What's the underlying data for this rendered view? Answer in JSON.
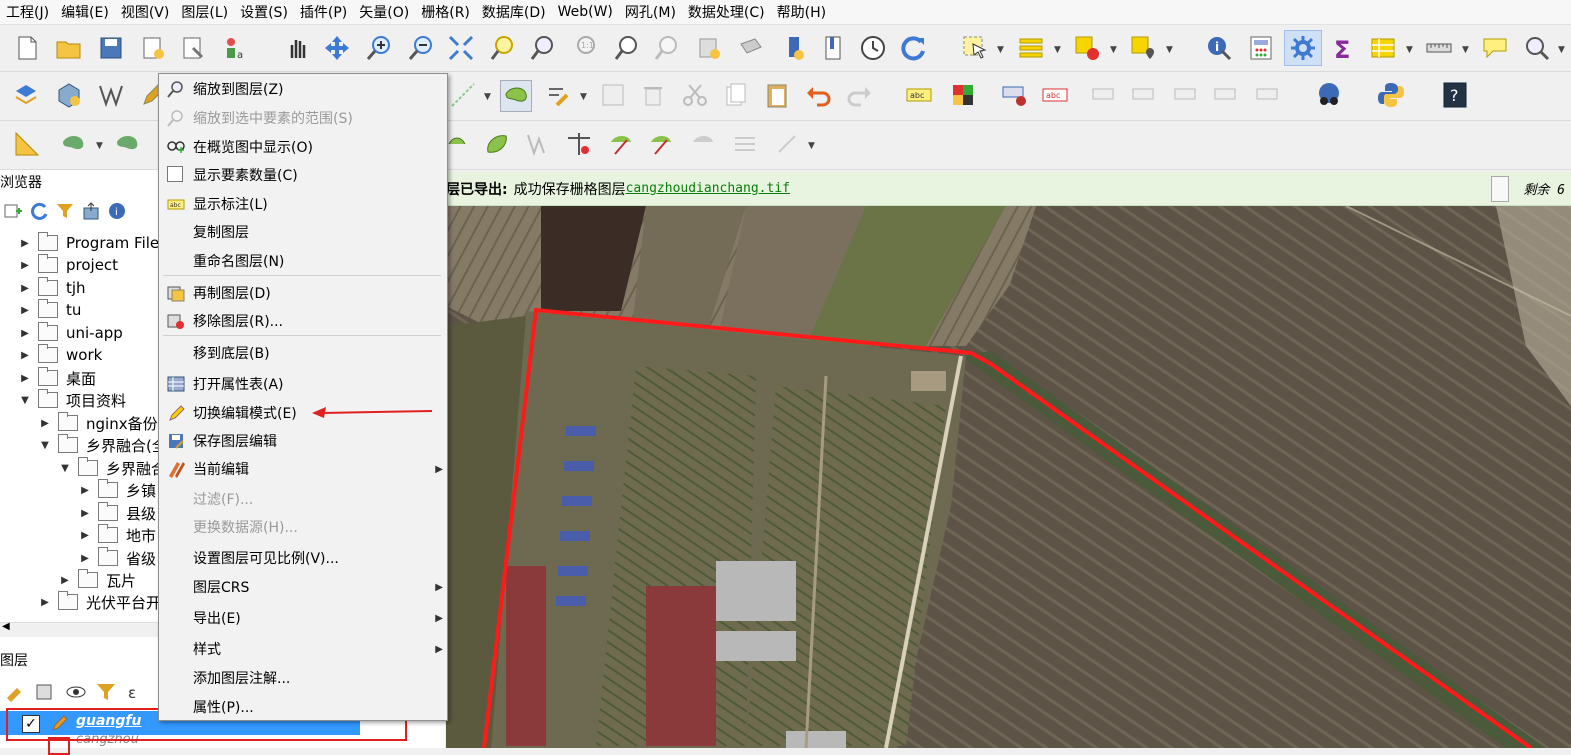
{
  "menubar": [
    "工程(J)",
    "编辑(E)",
    "视图(V)",
    "图层(L)",
    "设置(S)",
    "插件(P)",
    "矢量(O)",
    "栅格(R)",
    "数据库(D)",
    "Web(W)",
    "网孔(M)",
    "数据处理(C)",
    "帮助(H)"
  ],
  "message_bar": {
    "prefix": "层已导出:",
    "text": "成功保存栅格图层",
    "link": "cangzhoudianchang.tif",
    "remaining": "剩余 6"
  },
  "browser": {
    "title": "浏览器",
    "items": [
      {
        "label": "Program Files",
        "indent": 0,
        "expanded": false
      },
      {
        "label": "project",
        "indent": 0,
        "expanded": false
      },
      {
        "label": "tjh",
        "indent": 0,
        "expanded": false
      },
      {
        "label": "tu",
        "indent": 0,
        "expanded": false
      },
      {
        "label": "uni-app",
        "indent": 0,
        "expanded": false
      },
      {
        "label": "work",
        "indent": 0,
        "expanded": false
      },
      {
        "label": "桌面",
        "indent": 0,
        "expanded": false
      },
      {
        "label": "项目资料",
        "indent": 0,
        "expanded": true
      },
      {
        "label": "nginx备份",
        "indent": 1,
        "expanded": false
      },
      {
        "label": "乡界融合(全",
        "indent": 1,
        "expanded": true
      },
      {
        "label": "乡界融合",
        "indent": 2,
        "expanded": true
      },
      {
        "label": "乡镇",
        "indent": 3,
        "expanded": false
      },
      {
        "label": "县级",
        "indent": 3,
        "expanded": false
      },
      {
        "label": "地市",
        "indent": 3,
        "expanded": false
      },
      {
        "label": "省级",
        "indent": 3,
        "expanded": false
      },
      {
        "label": "瓦片",
        "indent": 2,
        "expanded": false
      },
      {
        "label": "光伏平台开",
        "indent": 1,
        "expanded": false
      }
    ]
  },
  "layers": {
    "title": "图层",
    "rows": [
      {
        "name": "guangfu",
        "checked": true,
        "selected": true
      },
      {
        "name": "cangzhou",
        "checked": false,
        "selected": false
      }
    ]
  },
  "context_menu": {
    "items": [
      {
        "label": "缩放到图层(Z)",
        "icon": "zoom-icon",
        "enabled": true
      },
      {
        "label": "缩放到选中要素的范围(S)",
        "icon": "zoom-selection-icon",
        "enabled": false
      },
      {
        "label": "在概览图中显示(O)",
        "icon": "overview-icon",
        "enabled": true
      },
      {
        "label": "显示要素数量(C)",
        "icon": "checkbox",
        "enabled": true
      },
      {
        "label": "显示标注(L)",
        "icon": "label-icon",
        "enabled": true
      },
      {
        "label": "复制图层",
        "icon": "",
        "enabled": true
      },
      {
        "label": "重命名图层(N)",
        "icon": "",
        "enabled": true
      },
      {
        "label": "再制图层(D)",
        "icon": "duplicate-icon",
        "enabled": true,
        "sep_before": true
      },
      {
        "label": "移除图层(R)...",
        "icon": "remove-icon",
        "enabled": true
      },
      {
        "label": "移到底层(B)",
        "icon": "",
        "enabled": true,
        "sep_before": true
      },
      {
        "label": "打开属性表(A)",
        "icon": "table-icon",
        "enabled": true
      },
      {
        "label": "切换编辑模式(E)",
        "icon": "pencil-icon",
        "enabled": true
      },
      {
        "label": "保存图层编辑",
        "icon": "save-edits-icon",
        "enabled": true
      },
      {
        "label": "当前编辑",
        "icon": "edits-icon",
        "enabled": true,
        "submenu": true
      },
      {
        "label": "过滤(F)...",
        "icon": "",
        "enabled": false
      },
      {
        "label": "更换数据源(H)...",
        "icon": "",
        "enabled": false
      },
      {
        "label": "设置图层可见比例(V)...",
        "icon": "",
        "enabled": true
      },
      {
        "label": "图层CRS",
        "icon": "",
        "enabled": true,
        "submenu": true
      },
      {
        "label": "导出(E)",
        "icon": "",
        "enabled": true,
        "submenu": true
      },
      {
        "label": "样式",
        "icon": "",
        "enabled": true,
        "submenu": true
      },
      {
        "label": "添加图层注解...",
        "icon": "",
        "enabled": true
      },
      {
        "label": "属性(P)...",
        "icon": "",
        "enabled": true
      }
    ]
  },
  "colors": {
    "accent": "#3399ff",
    "annotation": "#e02020",
    "msg_bg": "#e8f4e0",
    "boundary": "#ff1a1a"
  }
}
